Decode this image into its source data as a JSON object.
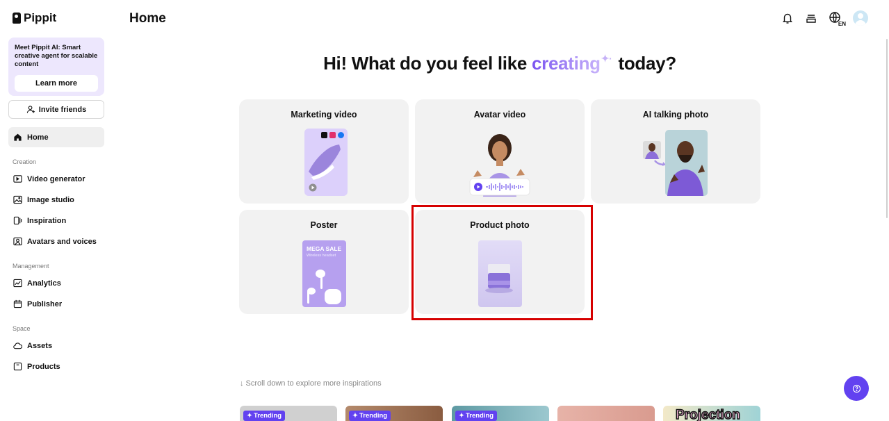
{
  "sidebar": {
    "logo_text": "Pippit",
    "promo": {
      "text": "Meet Pippit AI: Smart creative agent for scalable content",
      "button": "Learn more"
    },
    "invite_label": "Invite friends",
    "home_label": "Home",
    "sections": {
      "creation": "Creation",
      "management": "Management",
      "space": "Space"
    },
    "creation_items": [
      "Video generator",
      "Image studio",
      "Inspiration",
      "Avatars and voices"
    ],
    "management_items": [
      "Analytics",
      "Publisher"
    ],
    "space_items": [
      "Assets",
      "Products"
    ]
  },
  "header": {
    "title": "Home",
    "language_code": "EN",
    "icons": [
      "bell-icon",
      "subscription-icon",
      "globe-icon",
      "avatar"
    ]
  },
  "hero": {
    "before": "Hi! What do you feel like",
    "accent": "creating",
    "after": "today?"
  },
  "cards": [
    {
      "title": "Marketing video"
    },
    {
      "title": "Avatar video"
    },
    {
      "title": "AI talking photo"
    },
    {
      "title": "Poster",
      "poster_heading": "MEGA SALE",
      "poster_sub": "Wireless headset"
    },
    {
      "title": "Product photo"
    }
  ],
  "scroll_hint": "↓ Scroll down to explore more inspirations",
  "inspirations": [
    {
      "badge": "Trending"
    },
    {
      "badge": "Trending"
    },
    {
      "badge": "Trending"
    },
    {
      "badge": ""
    },
    {
      "text": "Projection"
    }
  ],
  "colors": {
    "accent": "#6242f0",
    "card_bg": "#f2f2f2",
    "promo_bg": "#ede7fd",
    "highlight": "#d60000"
  }
}
